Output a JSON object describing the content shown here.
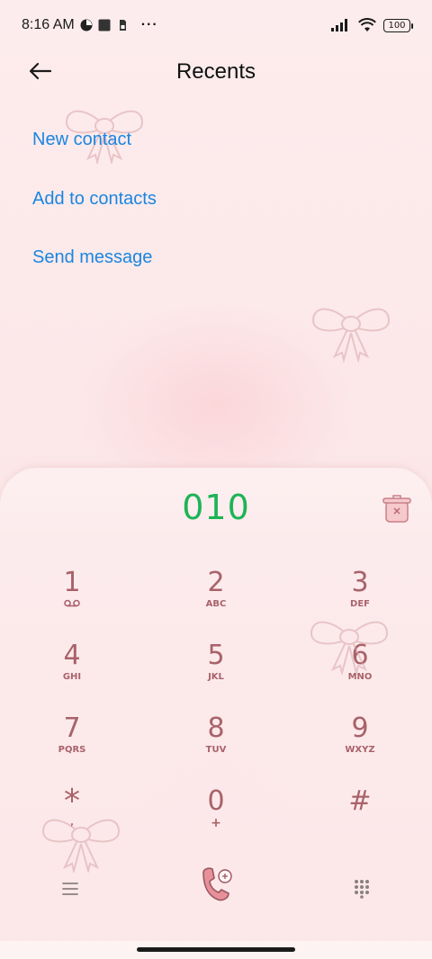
{
  "status_bar": {
    "time": "8:16 AM",
    "more_indicator": "···",
    "battery_level": "100",
    "icons": [
      "screen-record-icon",
      "square-icon",
      "sim-icon",
      "signal-icon",
      "wifi-icon",
      "battery-icon"
    ]
  },
  "header": {
    "title": "Recents",
    "back_icon": "back-arrow-icon"
  },
  "actions": [
    {
      "label": "New contact"
    },
    {
      "label": "Add to contacts"
    },
    {
      "label": "Send message"
    }
  ],
  "dialer": {
    "number": "010",
    "delete_icon": "delete-bin-icon",
    "keys": [
      {
        "digit": "1",
        "sub": "voicemail"
      },
      {
        "digit": "2",
        "sub": "ABC"
      },
      {
        "digit": "3",
        "sub": "DEF"
      },
      {
        "digit": "4",
        "sub": "GHI"
      },
      {
        "digit": "5",
        "sub": "JKL"
      },
      {
        "digit": "6",
        "sub": "MNO"
      },
      {
        "digit": "7",
        "sub": "PQRS"
      },
      {
        "digit": "8",
        "sub": "TUV"
      },
      {
        "digit": "9",
        "sub": "WXYZ"
      },
      {
        "digit": "*",
        "sub": ","
      },
      {
        "digit": "0",
        "sub": "+"
      },
      {
        "digit": "#",
        "sub": ""
      }
    ]
  },
  "bottom_bar": {
    "menu_icon": "menu-icon",
    "call_icon": "call-icon",
    "keypad_icon": "keypad-icon"
  },
  "colors": {
    "accent_link": "#1a86e0",
    "number_green": "#1cb457",
    "key_rose": "#a8626a",
    "background": "#fdeaea"
  }
}
